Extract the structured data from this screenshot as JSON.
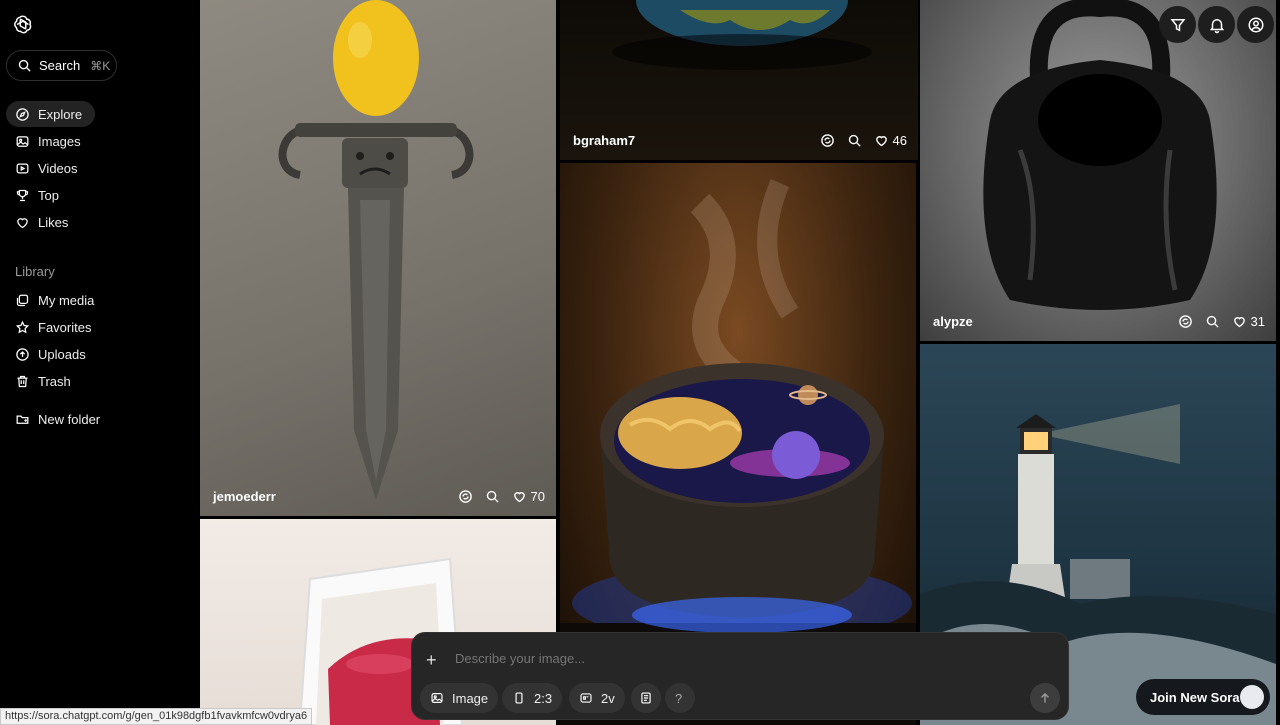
{
  "sidebar": {
    "search_label": "Search",
    "search_shortcut": "⌘K",
    "nav": [
      {
        "label": "Explore",
        "icon": "compass-icon"
      },
      {
        "label": "Images",
        "icon": "image-icon"
      },
      {
        "label": "Videos",
        "icon": "video-icon"
      },
      {
        "label": "Top",
        "icon": "trophy-icon"
      },
      {
        "label": "Likes",
        "icon": "heart-icon"
      }
    ],
    "library_label": "Library",
    "library": [
      {
        "label": "My media",
        "icon": "media-icon"
      },
      {
        "label": "Favorites",
        "icon": "star-icon"
      },
      {
        "label": "Uploads",
        "icon": "upload-icon"
      },
      {
        "label": "Trash",
        "icon": "trash-icon"
      }
    ],
    "new_folder_label": "New folder"
  },
  "feed": [
    {
      "author": "jemoederr",
      "likes": "70"
    },
    {
      "author": "bgraham7",
      "likes": "46"
    },
    {
      "author": "alypze",
      "likes": "31"
    }
  ],
  "composer": {
    "placeholder": "Describe your image...",
    "chips": {
      "type": "Image",
      "ratio": "2:3",
      "variations": "2v",
      "help": "?"
    }
  },
  "join_label": "Join New Sora",
  "status_url": "https://sora.chatgpt.com/g/gen_01k98dgfb1fvavkmfcw0vdrya6",
  "colors": {
    "background": "#000000",
    "panel": "#262626",
    "active_nav": "#232323"
  }
}
